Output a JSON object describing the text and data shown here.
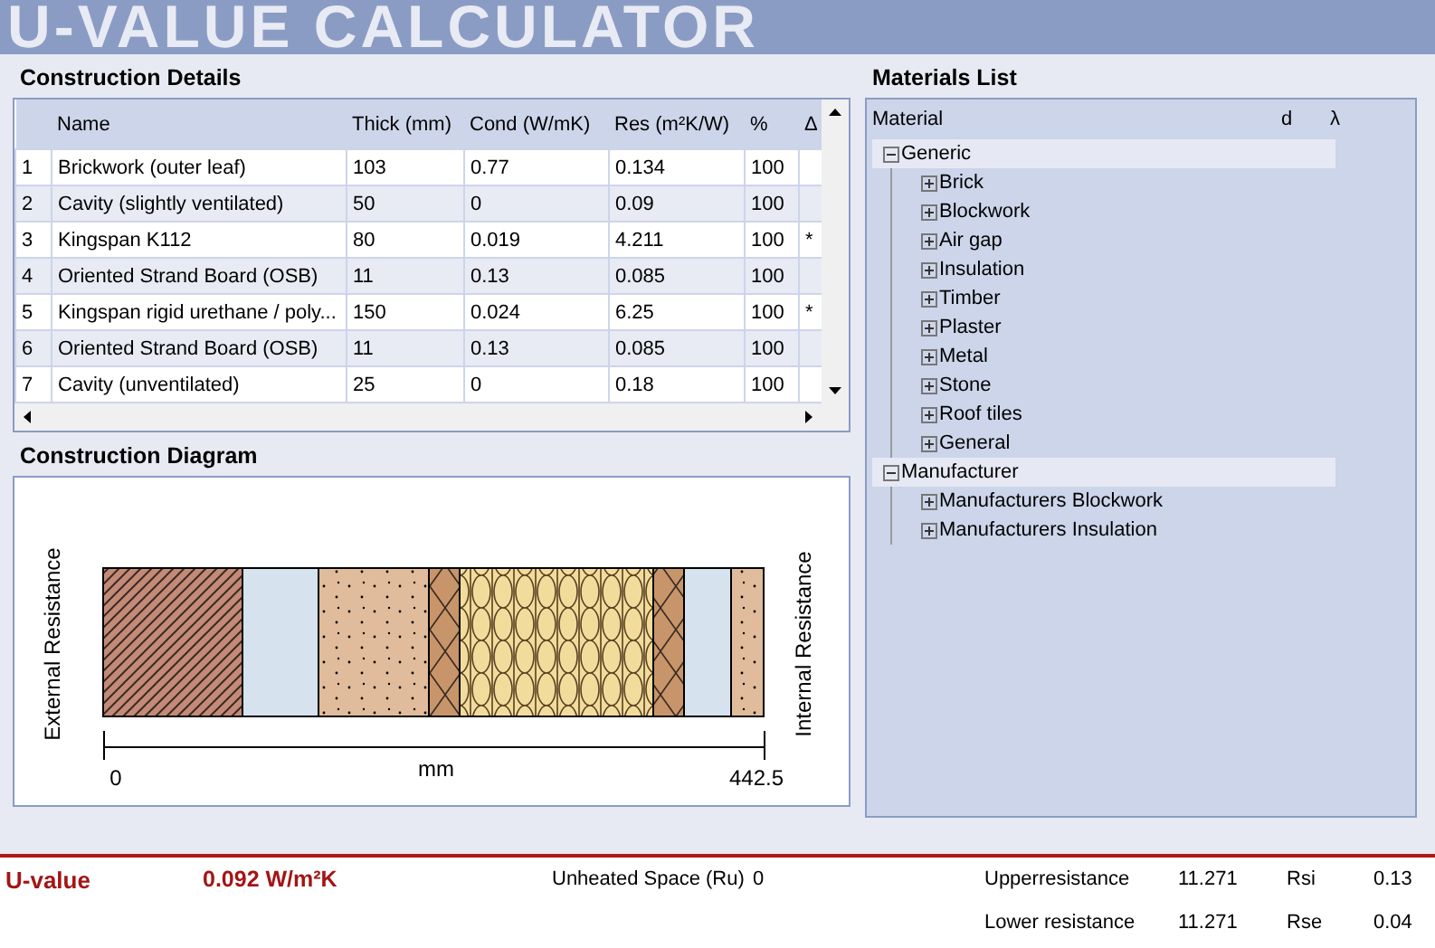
{
  "title": "U-VALUE CALCULATOR",
  "construction_details": {
    "heading": "Construction Details",
    "columns": [
      "",
      "Name",
      "Thick (mm)",
      "Cond (W/mK)",
      "Res (m²K/W)",
      "%",
      "Δ"
    ],
    "rows": [
      {
        "cells": [
          "1",
          "Brickwork (outer leaf)",
          "103",
          "0.77",
          "0.134",
          "100",
          ""
        ]
      },
      {
        "cells": [
          "2",
          "Cavity (slightly ventilated)",
          "50",
          "0",
          "0.09",
          "100",
          ""
        ]
      },
      {
        "cells": [
          "3",
          "Kingspan K112",
          "80",
          "0.019",
          "4.211",
          "100",
          "*"
        ]
      },
      {
        "cells": [
          "4",
          "Oriented Strand Board (OSB)",
          "11",
          "0.13",
          "0.085",
          "100",
          ""
        ]
      },
      {
        "cells": [
          "5",
          "Kingspan rigid urethane / poly...",
          "150",
          "0.024",
          "6.25",
          "100",
          "*"
        ]
      },
      {
        "cells": [
          "6",
          "Oriented Strand Board (OSB)",
          "11",
          "0.13",
          "0.085",
          "100",
          ""
        ]
      },
      {
        "cells": [
          "7",
          "Cavity (unventilated)",
          "25",
          "0",
          "0.18",
          "100",
          ""
        ]
      }
    ]
  },
  "construction_diagram": {
    "heading": "Construction Diagram",
    "external_label": "External Resistance",
    "internal_label": "Internal Resistance",
    "axis_start": "0",
    "axis_unit": "mm",
    "axis_end": "442.5"
  },
  "materials_list": {
    "heading": "Materials List",
    "columns": [
      "Material",
      "d",
      "λ"
    ],
    "tree": [
      {
        "label": "Generic",
        "expanded": true,
        "children": [
          {
            "label": "Brick",
            "expanded": false
          },
          {
            "label": "Blockwork",
            "expanded": false
          },
          {
            "label": "Air gap",
            "expanded": false
          },
          {
            "label": "Insulation",
            "expanded": false
          },
          {
            "label": "Timber",
            "expanded": false
          },
          {
            "label": "Plaster",
            "expanded": false
          },
          {
            "label": "Metal",
            "expanded": false
          },
          {
            "label": "Stone",
            "expanded": false
          },
          {
            "label": "Roof tiles",
            "expanded": false
          },
          {
            "label": "General",
            "expanded": false
          }
        ]
      },
      {
        "label": "Manufacturer",
        "expanded": true,
        "children": [
          {
            "label": "Manufacturers Blockwork",
            "expanded": false
          },
          {
            "label": "Manufacturers Insulation",
            "expanded": false
          }
        ]
      }
    ]
  },
  "footer": {
    "u_label": "U-value",
    "u_value": "0.092 W/m²K",
    "unheated_label": "Unheated Space (Ru)",
    "unheated_value": "0",
    "rows": [
      {
        "label": "Upperresistance",
        "value": "11.271",
        "r_label": "Rsi",
        "r_value": "0.13"
      },
      {
        "label": "Lower resistance",
        "value": "11.271",
        "r_label": "Rse",
        "r_value": "0.04"
      }
    ]
  }
}
